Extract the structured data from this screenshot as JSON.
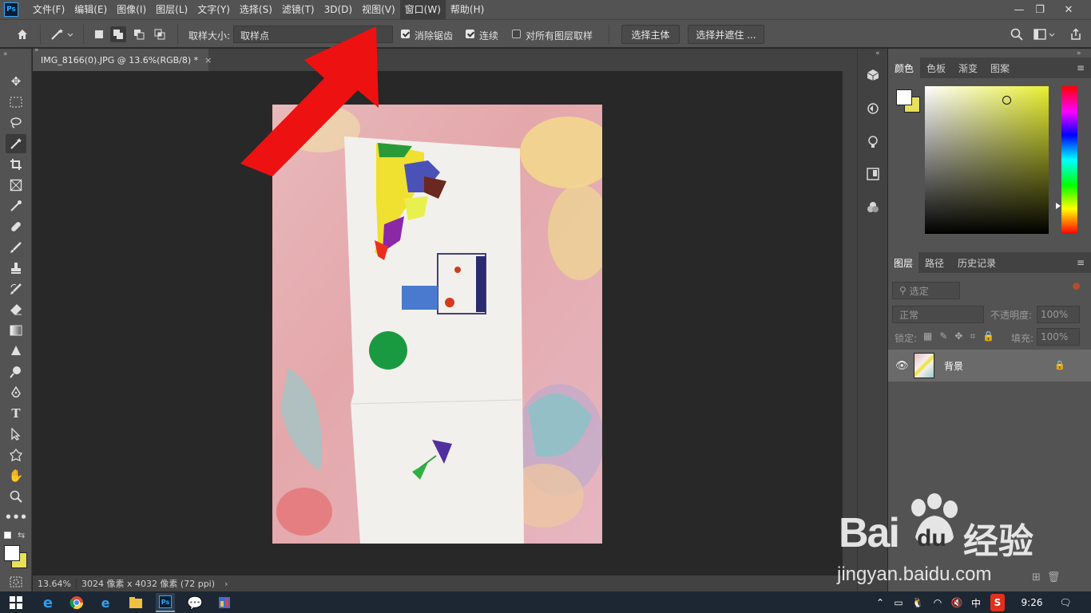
{
  "menu": {
    "app_logo": "Ps",
    "items": [
      "文件(F)",
      "编辑(E)",
      "图像(I)",
      "图层(L)",
      "文字(Y)",
      "选择(S)",
      "滤镜(T)",
      "3D(D)",
      "视图(V)",
      "窗口(W)",
      "帮助(H)"
    ]
  },
  "window_controls": {
    "minimize": "—",
    "restore": "❐",
    "close": "✕"
  },
  "options": {
    "sample_size_label": "取样大小:",
    "sample_size_value": "取样点",
    "anti_alias_label": "消除锯齿",
    "contiguous_label": "连续",
    "sample_all_layers_label": "对所有图层取样",
    "select_subject_button": "选择主体",
    "select_mask_button": "选择并遮住 ...",
    "anti_alias_checked": true,
    "contiguous_checked": true,
    "sample_all_checked": false
  },
  "document": {
    "tab_title": "IMG_8166(0).JPG @ 13.6%(RGB/8) *",
    "tab_close": "×"
  },
  "status": {
    "zoom": "13.64%",
    "doc_info": "3024 像素 x 4032 像素 (72 ppi)",
    "arrow": "›"
  },
  "color_panel": {
    "tabs": [
      "颜色",
      "色板",
      "渐变",
      "图案"
    ],
    "foreground": "#ffffff",
    "background": "#e6e05a",
    "hue_color": "#e8f030"
  },
  "layers_panel": {
    "tabs": [
      "图层",
      "路径",
      "历史记录"
    ],
    "filter_placeholder": "选定",
    "blend_mode": "正常",
    "opacity_label": "不透明度:",
    "opacity_value": "100%",
    "lock_label": "锁定:",
    "fill_label": "填充:",
    "fill_value": "100%",
    "layers": [
      {
        "name": "背景",
        "visible": true,
        "locked": true
      }
    ]
  },
  "taskbar": {
    "time": "9:26",
    "ime": "中"
  },
  "watermark": {
    "brand": "Bai",
    "brand2": "du",
    "brand_cn": "经验",
    "url": "jingyan.baidu.com"
  },
  "colors": {
    "annotation_arrow": "#ee1111",
    "ui_dark": "#282828",
    "ui_panel": "#535353"
  }
}
